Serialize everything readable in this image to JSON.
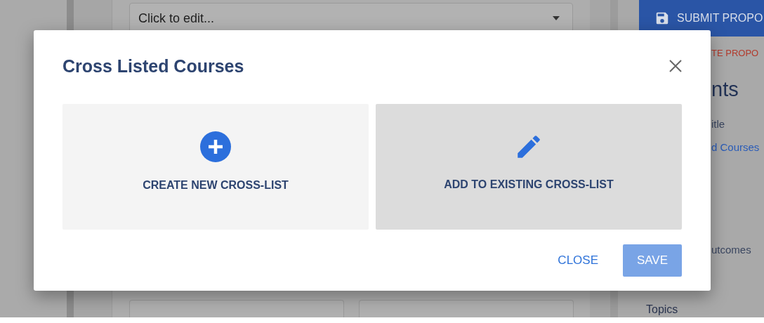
{
  "page": {
    "course_field": {
      "value": "Click to edit..."
    },
    "sidebar": {
      "submit_button": "SUBMIT PROPO",
      "delete_link": "TE PROPO",
      "heading": "nts",
      "items": [
        {
          "label": "itle",
          "kind": "text"
        },
        {
          "label": "d Courses",
          "kind": "link"
        },
        {
          "label": "utcomes",
          "kind": "text"
        }
      ],
      "bottom_item": "Topics"
    }
  },
  "dialog": {
    "title": "Cross Listed Courses",
    "options": [
      {
        "label": "CREATE NEW CROSS-LIST",
        "kind": "create",
        "selected": false
      },
      {
        "label": "ADD TO EXISTING CROSS-LIST",
        "kind": "edit",
        "selected": true
      }
    ],
    "close_button": "CLOSE",
    "save_button": {
      "label": "SAVE",
      "disabled": true
    }
  }
}
